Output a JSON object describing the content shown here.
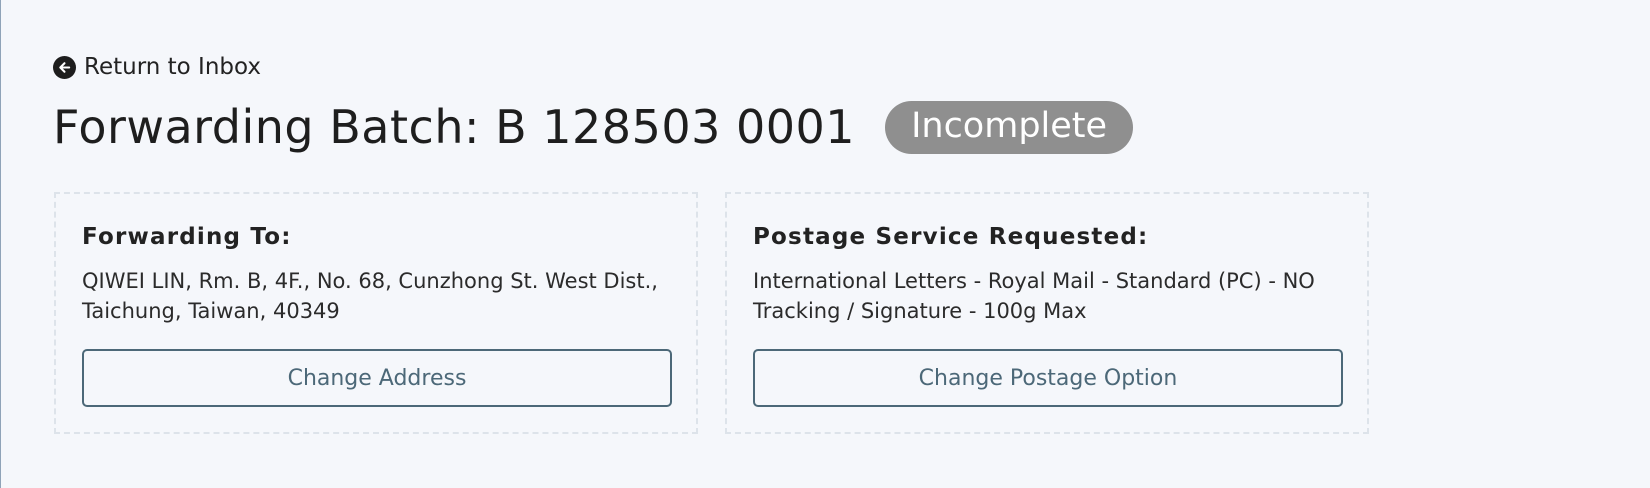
{
  "nav": {
    "back_label": "Return to Inbox",
    "back_icon": "arrow-left-circle-icon"
  },
  "header": {
    "title": "Forwarding Batch: B 128503 0001",
    "status": "Incomplete",
    "status_color": "#8f8f8f"
  },
  "forwarding": {
    "heading": "Forwarding To:",
    "address": "QIWEI LIN, Rm. B, 4F., No. 68, Cunzhong St. West Dist., Taichung, Taiwan, 40349",
    "button_label": "Change Address"
  },
  "postage": {
    "heading": "Postage Service Requested:",
    "service": "International Letters - Royal Mail - Standard (PC) - NO Tracking / Signature - 100g Max",
    "button_label": "Change Postage Option"
  },
  "colors": {
    "background": "#f5f7fb",
    "button_accent": "#4c6878",
    "card_border": "#dde3ea"
  }
}
